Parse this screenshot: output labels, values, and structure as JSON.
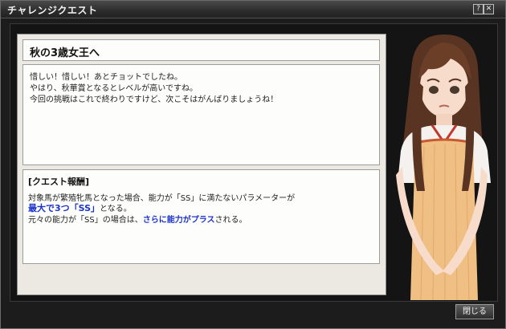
{
  "window": {
    "title": "チャレンジクエスト",
    "help_label": "?",
    "close_label": "✕"
  },
  "quest": {
    "name": "秋の3歳女王へ",
    "message": [
      "惜しい！惜しい！あとチョットでしたね。",
      "やはり、秋華賞となるとレベルが高いですね。",
      "今回の挑戦はこれで終わりですけど、次こそはがんばりましょうね！"
    ]
  },
  "reward": {
    "heading": "[クエスト報酬]",
    "line1": "対象馬が繁殖牝馬となった場合、能力が「SS」に満たないパラメーターが",
    "line2": "最大で3つ「SS」",
    "line2_suffix": "となる。",
    "line3_prefix": "元々の能力が「SS」の場合は、",
    "line3_highlight": "さらに能力がプラス",
    "line3_suffix": "される。"
  },
  "footer": {
    "close_button": "閉じる"
  },
  "colors": {
    "highlight": "#1c33c8",
    "panel_bg": "#ece9e2"
  }
}
